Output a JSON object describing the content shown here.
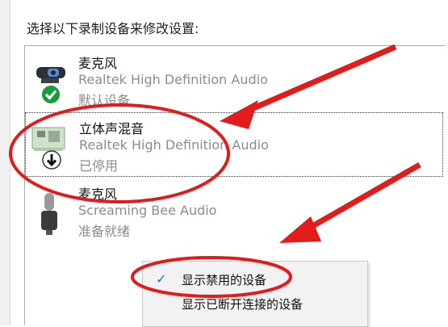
{
  "instruction": "选择以下录制设备来修改设置:",
  "devices": [
    {
      "name": "麦克风",
      "driver": "Realtek High Definition Audio",
      "status": "默认设备",
      "icon": "webcam-microphone-icon"
    },
    {
      "name": "立体声混音",
      "driver": "Realtek High Definition Audio",
      "status": "已停用",
      "icon": "sound-card-icon"
    },
    {
      "name": "麦克风",
      "driver": "Screaming Bee Audio",
      "status": "准备就绪",
      "icon": "microphone-icon"
    }
  ],
  "context_menu": {
    "items": [
      {
        "label": "显示禁用的设备",
        "checked": true
      },
      {
        "label": "显示已断开连接的设备",
        "checked": false
      }
    ]
  },
  "colors": {
    "annotation_red": "#e21b1b",
    "default_badge_green": "#1a9b3a",
    "check_blue": "#1e6fd6"
  }
}
